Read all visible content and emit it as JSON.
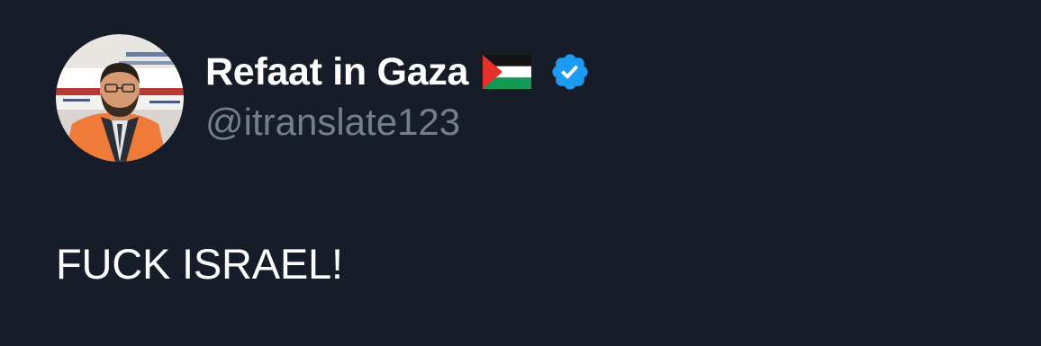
{
  "tweet": {
    "author": {
      "display_name": "Refaat in Gaza",
      "handle": "@itranslate123",
      "name_emoji": "palestine-flag-icon",
      "verified": true
    },
    "text": "FUCK ISRAEL!"
  },
  "colors": {
    "background": "#161c28",
    "name": "#ffffff",
    "handle": "#747f8d",
    "verified_badge": "#1d9bf0",
    "text": "#ffffff"
  }
}
